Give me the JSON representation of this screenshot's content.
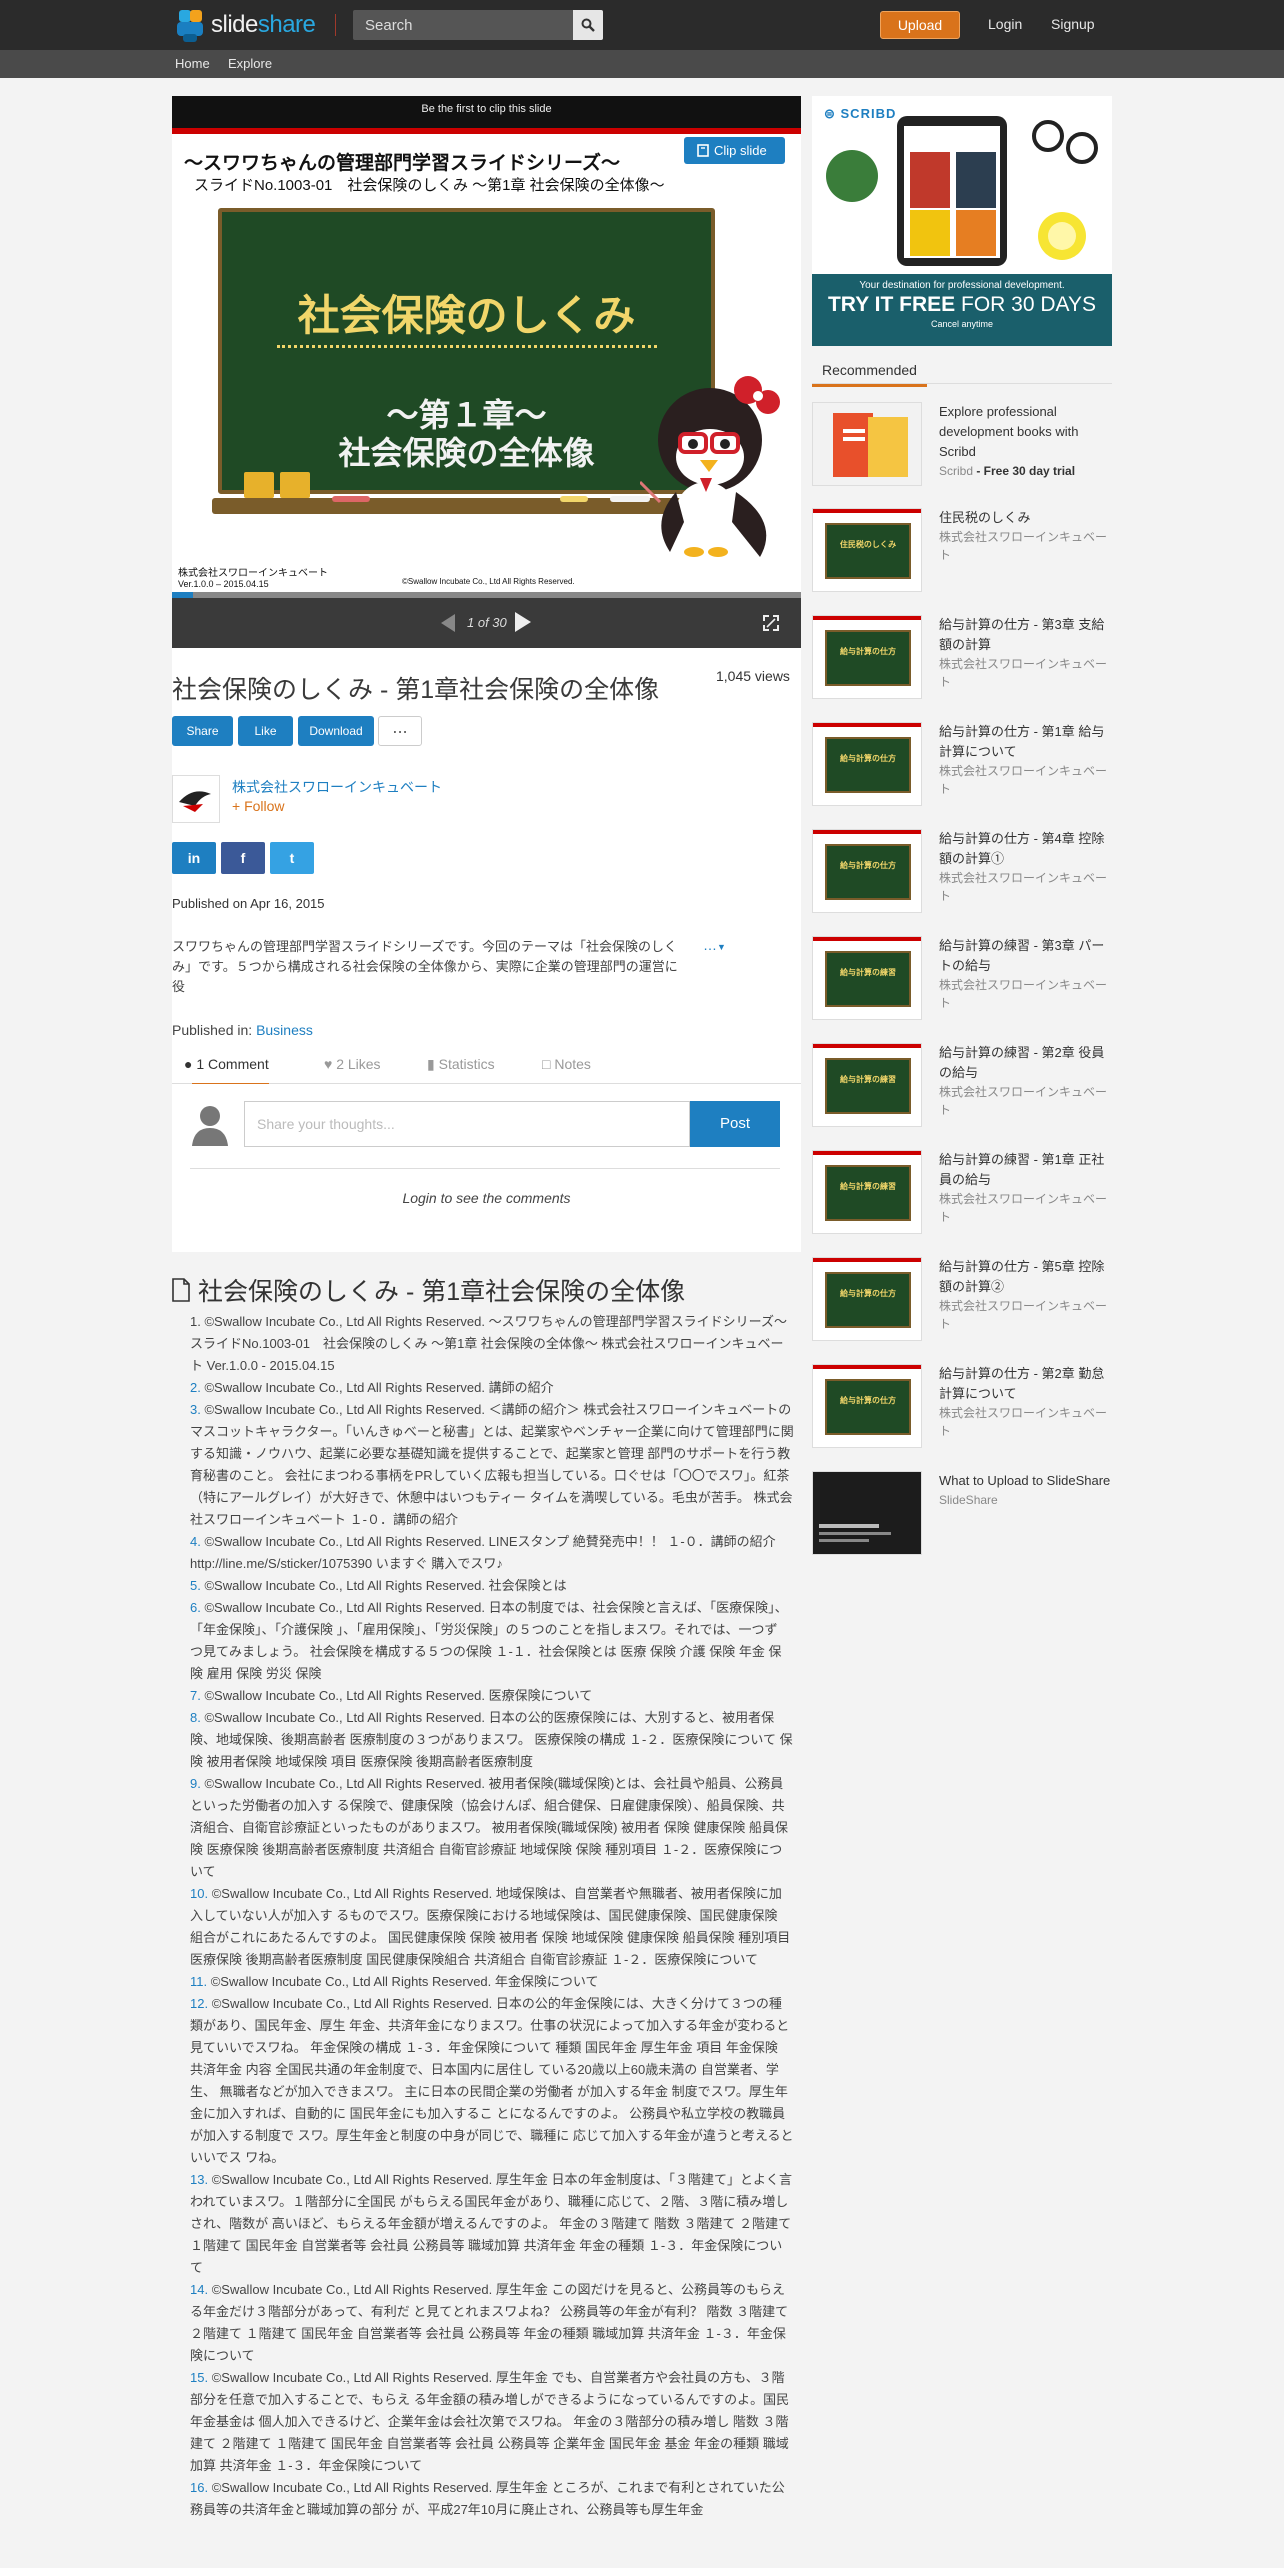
{
  "header": {
    "logo_main": "slide",
    "logo_accent": "share",
    "search_placeholder": "Search",
    "upload_label": "Upload",
    "login_label": "Login",
    "signup_label": "Signup"
  },
  "subnav": {
    "home": "Home",
    "explore": "Explore"
  },
  "player": {
    "clip_banner": "Be the first to clip this slide",
    "clip_button": "Clip slide",
    "slide_series": "〜スワワちゃんの管理部門学習スライドシリーズ〜",
    "slide_number": "スライドNo.1003-01　社会保険のしくみ 〜第1章 社会保険の全体像〜",
    "board_title": "社会保険のしくみ",
    "board_chapter": "〜第１章〜",
    "board_subtitle": "社会保険の全体像",
    "footer_company": "株式会社スワローインキュベート",
    "footer_version": "Ver.1.0.0 – 2015.04.15",
    "footer_copyright": "©Swallow Incubate Co., Ltd All Rights Reserved.",
    "page_indicator": "1 of 30",
    "progress": 0.033
  },
  "meta": {
    "title": "社会保険のしくみ - 第1章社会保険の全体像",
    "views": "1,045 views",
    "share": "Share",
    "like": "Like",
    "download": "Download",
    "more": "...",
    "author": "株式会社スワローインキュベート",
    "follow": "+ Follow",
    "linkedin": "in",
    "facebook": "f",
    "twitter": "t",
    "published": "Published on Apr 16, 2015",
    "description": "スワワちゃんの管理部門学習スライドシリーズです。今回のテーマは「社会保険のしくみ」です。５つから構成される社会保険の全体像から、実際に企業の管理部門の運営に役",
    "desc_more": "…",
    "published_in_label": "Published in: ",
    "category": "Business"
  },
  "tabs": {
    "comments": "1 Comment",
    "likes": "2 Likes",
    "statistics": "Statistics",
    "notes": "Notes"
  },
  "comments": {
    "placeholder": "Share your thoughts...",
    "post": "Post",
    "login_note": "Login to see the comments"
  },
  "transcript": {
    "heading": "社会保険のしくみ - 第1章社会保険の全体像",
    "items": [
      {
        "n": "1.",
        "text": " ©Swallow Incubate Co., Ltd All Rights Reserved. 〜スワワちゃんの管理部門学習スライドシリーズ〜　 スライドNo.1003-01　社会保険のしくみ 〜第1章 社会保険の全体像〜 株式会社スワローインキュベート Ver.1.0.0 - 2015.04.15"
      },
      {
        "n": "2.",
        "text": " ©Swallow Incubate Co., Ltd All Rights Reserved. 講師の紹介"
      },
      {
        "n": "3.",
        "text": " ©Swallow Incubate Co., Ltd All Rights Reserved. ＜講師の紹介＞ 株式会社スワローインキュベートのマスコットキャラクター。「いんきゅべーと秘書」とは、起業家やベンチャー企業に向けて管理部門に関 する知識・ノウハウ、起業に必要な基礎知識を提供することで、起業家と管理 部門のサポートを行う教育秘書のこと。 会社にまつわる事柄をPRしていく広報も担当している。口ぐせは「〇〇でスワ」。紅茶（特にアールグレイ）が大好きで、休憩中はいつもティー タイムを満喫している。毛虫が苦手。 株式会社スワローインキュベート １-０．講師の紹介"
      },
      {
        "n": "4.",
        "text": " ©Swallow Incubate Co., Ltd All Rights Reserved. LINEスタンプ 絶賛発売中！！ １-０．講師の紹介 http://line.me/S/sticker/1075390 いますぐ 購入でスワ♪"
      },
      {
        "n": "5.",
        "text": " ©Swallow Incubate Co., Ltd All Rights Reserved. 社会保険とは"
      },
      {
        "n": "6.",
        "text": " ©Swallow Incubate Co., Ltd All Rights Reserved. 日本の制度では、社会保険と言えば、「医療保険」、「年金保険」、「介護保険 」、「雇用保険」、「労災保険」の５つのことを指しまスワ。それでは、一つず つ見てみましょう。 社会保険を構成する５つの保険 １-１．社会保険とは 医療 保険 介護 保険 年金 保険 雇用 保険 労災 保険"
      },
      {
        "n": "7.",
        "text": " ©Swallow Incubate Co., Ltd All Rights Reserved. 医療保険について"
      },
      {
        "n": "8.",
        "text": " ©Swallow Incubate Co., Ltd All Rights Reserved. 日本の公的医療保険には、大別すると、被用者保険、地域保険、後期高齢者 医療制度の３つがありまスワ。 医療保険の構成 １-２．医療保険について 保険 被用者保険 地域保険 項目 医療保険 後期高齢者医療制度"
      },
      {
        "n": "9.",
        "text": " ©Swallow Incubate Co., Ltd All Rights Reserved. 被用者保険(職域保険)とは、会社員や船員、公務員といった労働者の加入す る保険で、健康保険（協会けんぽ、組合健保、日雇健康保険）、船員保険、共 済組合、自衛官診療証といったものがありまスワ。 被用者保険(職域保険) 被用者 保険 健康保険 船員保険 医療保険 後期高齢者医療制度 共済組合 自衛官診療証 地域保険 保険 種別項目 １-２．医療保険について"
      },
      {
        "n": "10.",
        "text": " ©Swallow Incubate Co., Ltd All Rights Reserved. 地域保険は、自営業者や無職者、被用者保険に加入していない人が加入す るものでスワ。医療保険における地域保険は、国民健康保険、国民健康保険 組合がこれにあたるんですのよ。 国民健康保険 保険 被用者 保険 地域保険 健康保険 船員保険 種別項目 医療保険 後期高齢者医療制度 国民健康保険組合 共済組合 自衛官診療証 １-２．医療保険について"
      },
      {
        "n": "11.",
        "text": " ©Swallow Incubate Co., Ltd All Rights Reserved. 年金保険について"
      },
      {
        "n": "12.",
        "text": " ©Swallow Incubate Co., Ltd All Rights Reserved. 日本の公的年金保険には、大きく分けて３つの種類があり、国民年金、厚生 年金、共済年金になりまスワ。仕事の状況によって加入する年金が変わると 見ていいでスワね。 年金保険の構成 １-３．年金保険について 種類 国民年金 厚生年金 項目 年金保険 共済年金 内容 全国民共通の年金制度で、日本国内に居住し ている20歳以上60歳未満の 自営業者、学生、 無職者などが加入できまスワ。 主に日本の民間企業の労働者 が加入する年金 制度でスワ。厚生年金に加入すれば、自動的に 国民年金にも加入するこ とになるんですのよ。 公務員や私立学校の教職員 が加入する制度で スワ。厚生年金と制度の中身が同じで、職種に 応じて加入する年金が違うと考えるといいでス ワね。"
      },
      {
        "n": "13.",
        "text": " ©Swallow Incubate Co., Ltd All Rights Reserved. 厚生年金 日本の年金制度は、「３階建て」とよく言われていまスワ。１階部分に全国民 がもらえる国民年金があり、職種に応じて、２階、３階に積み増しされ、階数が 高いほど、もらえる年金額が増えるんですのよ。 年金の３階建て 階数 ３階建て ２階建て １階建て 国民年金 自営業者等 会社員 公務員等 職域加算 共済年金 年金の種類 １-３．年金保険について"
      },
      {
        "n": "14.",
        "text": " ©Swallow Incubate Co., Ltd All Rights Reserved. 厚生年金 この図だけを見ると、公務員等のもらえる年金だけ３階部分があって、有利だ と見てとれまスワよね？ 公務員等の年金が有利？ 階数 ３階建て ２階建て １階建て 国民年金 自営業者等 会社員 公務員等 年金の種類 職域加算 共済年金 １-３．年金保険について"
      },
      {
        "n": "15.",
        "text": " ©Swallow Incubate Co., Ltd All Rights Reserved. 厚生年金 でも、自営業者方や会社員の方も、３階部分を任意で加入することで、もらえ る年金額の積み増しができるようになっているんですのよ。国民年金基金は 個人加入できるけど、企業年金は会社次第でスワね。 年金の３階部分の積み増し 階数 ３階建て ２階建て １階建て 国民年金 自営業者等 会社員 公務員等 企業年金 国民年金 基金 年金の種類 職域加算 共済年金 １-３．年金保険について"
      },
      {
        "n": "16.",
        "text": " ©Swallow Incubate Co., Ltd All Rights Reserved. 厚生年金 ところが、これまで有利とされていた公務員等の共済年金と職域加算の部分 が、平成27年10月に廃止され、公務員等も厚生年金"
      }
    ]
  },
  "ad": {
    "brand": "SCRIBD",
    "line1": "Your destination for professional development.",
    "line2_a": "TRY IT FREE",
    "line2_b": " FOR 30 DAYS",
    "line3": "Cancel anytime"
  },
  "sidebar": {
    "recommended": "Recommended",
    "items": [
      {
        "title": "Explore professional development books with Scribd",
        "author": "Scribd",
        "extra": " - Free 30 day trial"
      },
      {
        "title": "住民税のしくみ",
        "author": "株式会社スワローインキュベート",
        "thumb": "住民税のしくみ"
      },
      {
        "title": "給与計算の仕方 - 第3章 支給額の計算",
        "author": "株式会社スワローインキュベート",
        "thumb": "給与計算の仕方"
      },
      {
        "title": "給与計算の仕方 - 第1章 給与計算について",
        "author": "株式会社スワローインキュベート",
        "thumb": "給与計算の仕方"
      },
      {
        "title": "給与計算の仕方 - 第4章 控除額の計算①",
        "author": "株式会社スワローインキュベート",
        "thumb": "給与計算の仕方"
      },
      {
        "title": "給与計算の練習 - 第3章 パートの給与",
        "author": "株式会社スワローインキュベート",
        "thumb": "給与計算の練習"
      },
      {
        "title": "給与計算の練習 - 第2章 役員の給与",
        "author": "株式会社スワローインキュベート",
        "thumb": "給与計算の練習"
      },
      {
        "title": "給与計算の練習 - 第1章 正社員の給与",
        "author": "株式会社スワローインキュベート",
        "thumb": "給与計算の練習"
      },
      {
        "title": "給与計算の仕方 - 第5章 控除額の計算②",
        "author": "株式会社スワローインキュベート",
        "thumb": "給与計算の仕方"
      },
      {
        "title": "給与計算の仕方 - 第2章 勤怠計算について",
        "author": "株式会社スワローインキュベート",
        "thumb": "給与計算の仕方"
      },
      {
        "title": "What to Upload to SlideShare",
        "author": "SlideShare"
      }
    ]
  },
  "colors": {
    "accent": "#1e7fc1",
    "orange": "#d9731b",
    "board": "#1f4a25"
  }
}
